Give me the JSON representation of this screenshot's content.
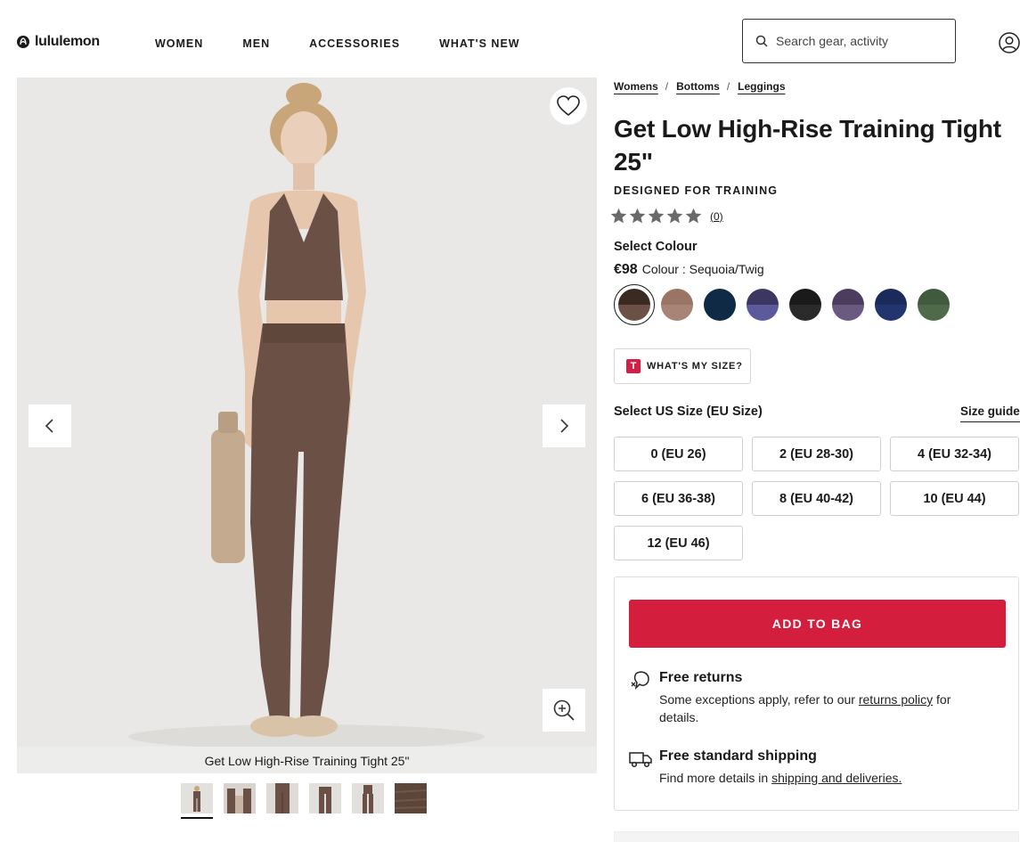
{
  "header": {
    "logo_text": "lululemon",
    "logo_mark": "⍺",
    "nav": [
      {
        "label": "WOMEN"
      },
      {
        "label": "MEN"
      },
      {
        "label": "ACCESSORIES"
      },
      {
        "label": "WHAT'S NEW"
      }
    ],
    "search_placeholder": "Search gear, activity"
  },
  "gallery": {
    "caption": "Get Low High-Rise Training Tight 25\"",
    "thumbnail_count": 6,
    "active_thumbnail": 1
  },
  "product": {
    "breadcrumb": [
      "Womens",
      "Bottoms",
      "Leggings"
    ],
    "title": "Get Low High-Rise Training Tight 25\"",
    "tagline": "DESIGNED FOR TRAINING",
    "rating": {
      "stars": 5,
      "value": 0,
      "review_count": "(0)"
    },
    "select_colour_label": "Select Colour",
    "price": "€98",
    "colour_label": "Colour : Sequoia/Twig",
    "swatches": [
      {
        "name": "Sequoia/Twig",
        "top": "#3a2a22",
        "bottom": "#6b5145",
        "selected": true
      },
      {
        "name": "swatch-2",
        "top": "#9a7566",
        "bottom": "#a88477"
      },
      {
        "name": "swatch-3",
        "top": "#0f2a44",
        "bottom": "#0f2a44"
      },
      {
        "name": "swatch-4",
        "top": "#3b3760",
        "bottom": "#5c5a9a"
      },
      {
        "name": "swatch-5",
        "top": "#1a1a1a",
        "bottom": "#2b2b2b"
      },
      {
        "name": "swatch-6",
        "top": "#4a3d5e",
        "bottom": "#6b5a80"
      },
      {
        "name": "swatch-7",
        "top": "#1a2a5a",
        "bottom": "#22356e"
      },
      {
        "name": "swatch-8",
        "top": "#3f5a3d",
        "bottom": "#4f6a49"
      }
    ],
    "size_help_label": "WHAT'S MY SIZE?",
    "size_help_icon": "T",
    "select_size_label": "Select US Size (EU Size)",
    "size_guide_label": "Size guide",
    "sizes": [
      "0 (EU 26)",
      "2 (EU 28-30)",
      "4 (EU 32-34)",
      "6 (EU 36-38)",
      "8 (EU 40-42)",
      "10 (EU 44)",
      "12 (EU 46)"
    ],
    "add_to_bag": "ADD TO BAG",
    "returns": {
      "title": "Free returns",
      "text_before": "Some exceptions apply, refer to our ",
      "link": "returns policy",
      "text_after": " for details."
    },
    "shipping": {
      "title": "Free standard shipping",
      "text_before": "Find more details in ",
      "link": "shipping and deliveries."
    }
  },
  "colors": {
    "accent_red": "#d31e3d",
    "product_brown": "#6b5145"
  }
}
